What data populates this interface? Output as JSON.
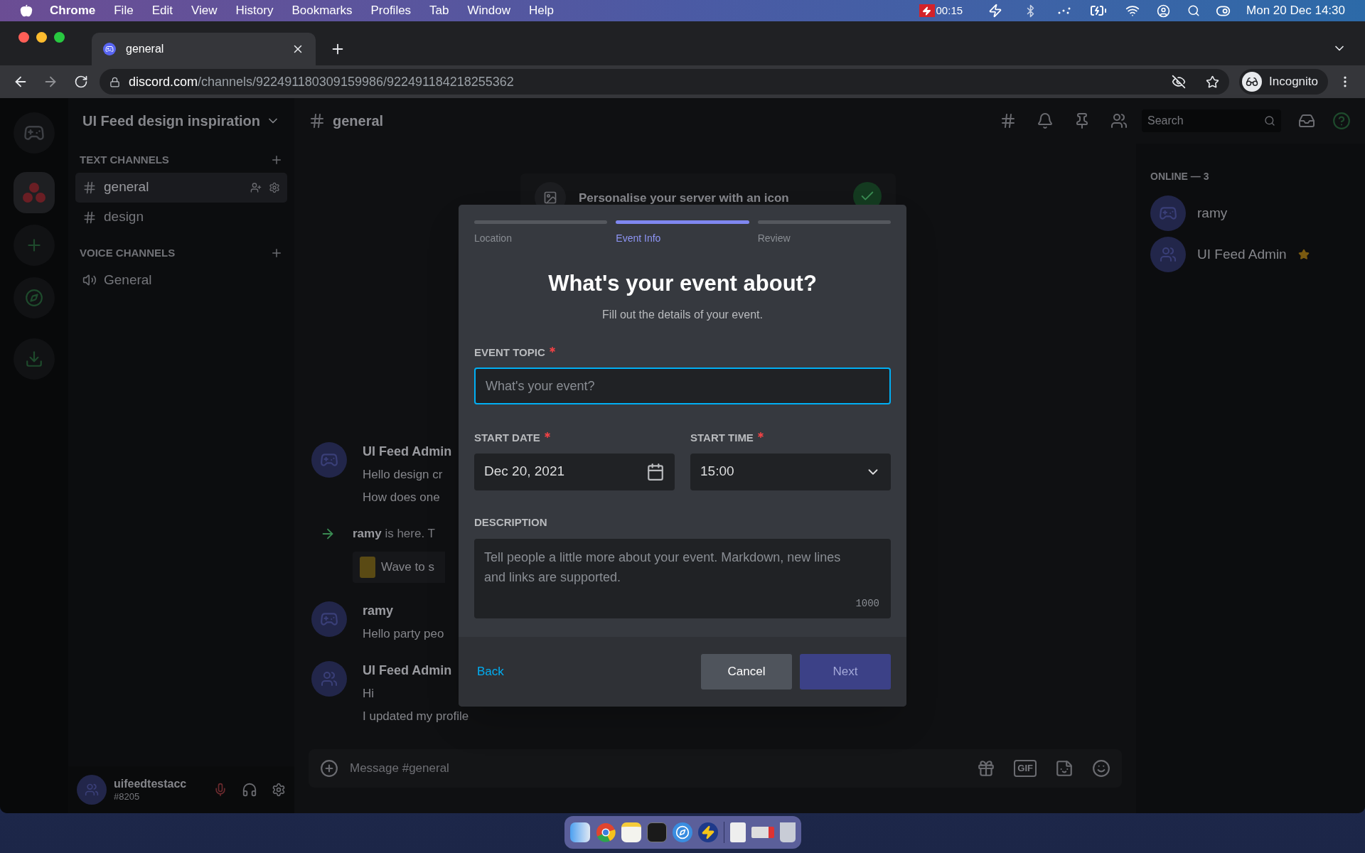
{
  "menu_bar": {
    "app": "Chrome",
    "menus": [
      "File",
      "Edit",
      "View",
      "History",
      "Bookmarks",
      "Profiles",
      "Tab",
      "Window",
      "Help"
    ],
    "recording_time": "00:15",
    "clock": "Mon 20 Dec  14:30"
  },
  "browser": {
    "tab_title": "general",
    "url_host": "discord.com",
    "url_path": "/channels/922491180309159986/922491184218255362",
    "profile": "Incognito"
  },
  "server": {
    "name": "UI Feed design inspiration",
    "categories": [
      {
        "name": "TEXT CHANNELS",
        "kind": "text",
        "channels": [
          {
            "name": "general",
            "selected": true
          },
          {
            "name": "design",
            "selected": false
          }
        ]
      },
      {
        "name": "VOICE CHANNELS",
        "kind": "voice",
        "channels": [
          {
            "name": "General",
            "selected": false
          }
        ]
      }
    ]
  },
  "user": {
    "name": "uifeedtestacc",
    "tag": "#8205"
  },
  "channel_header": {
    "name": "general",
    "search_placeholder": "Search"
  },
  "chat": {
    "banner": "Personalise your server with an icon",
    "messages": [
      {
        "kind": "message",
        "author": "UI Feed Admin",
        "lines": [
          "Hello design cr",
          "How does one"
        ]
      },
      {
        "kind": "join",
        "author": "ramy",
        "text": "is here. T",
        "button": "Wave to s"
      },
      {
        "kind": "message",
        "author": "ramy",
        "lines": [
          "Hello party peo"
        ]
      },
      {
        "kind": "message",
        "author": "UI Feed Admin",
        "lines": [
          "Hi",
          "I updated my profile"
        ]
      }
    ],
    "composer_placeholder": "Message #general",
    "gif": "GIF"
  },
  "members": {
    "heading": "ONLINE — 3",
    "list": [
      {
        "name": "ramy",
        "owner": false
      },
      {
        "name": "UI Feed Admin",
        "owner": true
      }
    ]
  },
  "modal": {
    "steps": [
      {
        "label": "Location",
        "selected": false
      },
      {
        "label": "Event Info",
        "selected": true
      },
      {
        "label": "Review",
        "selected": false
      }
    ],
    "title": "What's your event about?",
    "subtitle": "Fill out the details of your event.",
    "topic": {
      "label": "EVENT TOPIC",
      "required": true,
      "placeholder": "What's your event?",
      "focused": true
    },
    "start_date": {
      "label": "START DATE",
      "required": true,
      "value": "Dec 20, 2021"
    },
    "start_time": {
      "label": "START TIME",
      "required": true,
      "value": "15:00"
    },
    "description": {
      "label": "DESCRIPTION",
      "placeholder": "Tell people a little more about your event. Markdown, new lines and links are supported.",
      "counter": "1000"
    },
    "back": "Back",
    "cancel": "Cancel",
    "next": {
      "label": "Next",
      "disabled": true
    }
  }
}
